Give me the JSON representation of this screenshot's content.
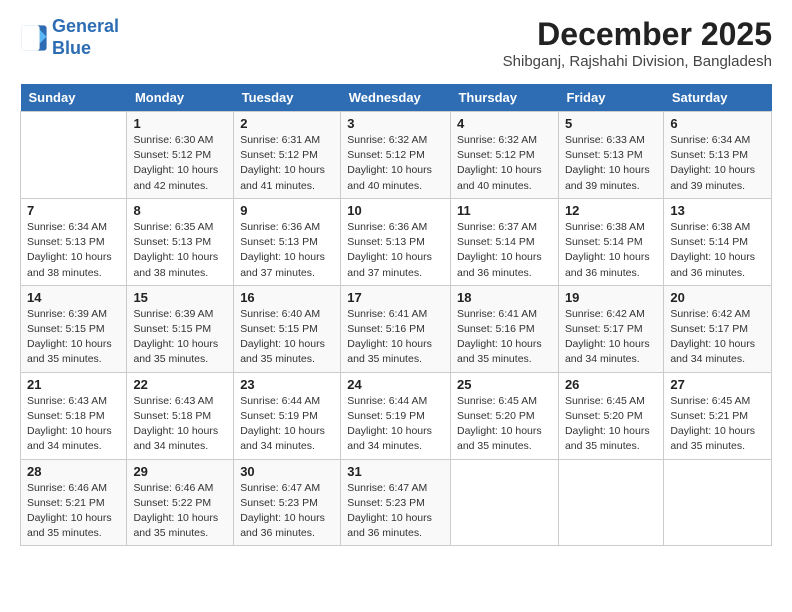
{
  "logo": {
    "line1": "General",
    "line2": "Blue"
  },
  "title": "December 2025",
  "subtitle": "Shibganj, Rajshahi Division, Bangladesh",
  "days_header": [
    "Sunday",
    "Monday",
    "Tuesday",
    "Wednesday",
    "Thursday",
    "Friday",
    "Saturday"
  ],
  "weeks": [
    [
      {
        "day": "",
        "sunrise": "",
        "sunset": "",
        "daylight": ""
      },
      {
        "day": "1",
        "sunrise": "Sunrise: 6:30 AM",
        "sunset": "Sunset: 5:12 PM",
        "daylight": "Daylight: 10 hours and 42 minutes."
      },
      {
        "day": "2",
        "sunrise": "Sunrise: 6:31 AM",
        "sunset": "Sunset: 5:12 PM",
        "daylight": "Daylight: 10 hours and 41 minutes."
      },
      {
        "day": "3",
        "sunrise": "Sunrise: 6:32 AM",
        "sunset": "Sunset: 5:12 PM",
        "daylight": "Daylight: 10 hours and 40 minutes."
      },
      {
        "day": "4",
        "sunrise": "Sunrise: 6:32 AM",
        "sunset": "Sunset: 5:12 PM",
        "daylight": "Daylight: 10 hours and 40 minutes."
      },
      {
        "day": "5",
        "sunrise": "Sunrise: 6:33 AM",
        "sunset": "Sunset: 5:13 PM",
        "daylight": "Daylight: 10 hours and 39 minutes."
      },
      {
        "day": "6",
        "sunrise": "Sunrise: 6:34 AM",
        "sunset": "Sunset: 5:13 PM",
        "daylight": "Daylight: 10 hours and 39 minutes."
      }
    ],
    [
      {
        "day": "7",
        "sunrise": "Sunrise: 6:34 AM",
        "sunset": "Sunset: 5:13 PM",
        "daylight": "Daylight: 10 hours and 38 minutes."
      },
      {
        "day": "8",
        "sunrise": "Sunrise: 6:35 AM",
        "sunset": "Sunset: 5:13 PM",
        "daylight": "Daylight: 10 hours and 38 minutes."
      },
      {
        "day": "9",
        "sunrise": "Sunrise: 6:36 AM",
        "sunset": "Sunset: 5:13 PM",
        "daylight": "Daylight: 10 hours and 37 minutes."
      },
      {
        "day": "10",
        "sunrise": "Sunrise: 6:36 AM",
        "sunset": "Sunset: 5:13 PM",
        "daylight": "Daylight: 10 hours and 37 minutes."
      },
      {
        "day": "11",
        "sunrise": "Sunrise: 6:37 AM",
        "sunset": "Sunset: 5:14 PM",
        "daylight": "Daylight: 10 hours and 36 minutes."
      },
      {
        "day": "12",
        "sunrise": "Sunrise: 6:38 AM",
        "sunset": "Sunset: 5:14 PM",
        "daylight": "Daylight: 10 hours and 36 minutes."
      },
      {
        "day": "13",
        "sunrise": "Sunrise: 6:38 AM",
        "sunset": "Sunset: 5:14 PM",
        "daylight": "Daylight: 10 hours and 36 minutes."
      }
    ],
    [
      {
        "day": "14",
        "sunrise": "Sunrise: 6:39 AM",
        "sunset": "Sunset: 5:15 PM",
        "daylight": "Daylight: 10 hours and 35 minutes."
      },
      {
        "day": "15",
        "sunrise": "Sunrise: 6:39 AM",
        "sunset": "Sunset: 5:15 PM",
        "daylight": "Daylight: 10 hours and 35 minutes."
      },
      {
        "day": "16",
        "sunrise": "Sunrise: 6:40 AM",
        "sunset": "Sunset: 5:15 PM",
        "daylight": "Daylight: 10 hours and 35 minutes."
      },
      {
        "day": "17",
        "sunrise": "Sunrise: 6:41 AM",
        "sunset": "Sunset: 5:16 PM",
        "daylight": "Daylight: 10 hours and 35 minutes."
      },
      {
        "day": "18",
        "sunrise": "Sunrise: 6:41 AM",
        "sunset": "Sunset: 5:16 PM",
        "daylight": "Daylight: 10 hours and 35 minutes."
      },
      {
        "day": "19",
        "sunrise": "Sunrise: 6:42 AM",
        "sunset": "Sunset: 5:17 PM",
        "daylight": "Daylight: 10 hours and 34 minutes."
      },
      {
        "day": "20",
        "sunrise": "Sunrise: 6:42 AM",
        "sunset": "Sunset: 5:17 PM",
        "daylight": "Daylight: 10 hours and 34 minutes."
      }
    ],
    [
      {
        "day": "21",
        "sunrise": "Sunrise: 6:43 AM",
        "sunset": "Sunset: 5:18 PM",
        "daylight": "Daylight: 10 hours and 34 minutes."
      },
      {
        "day": "22",
        "sunrise": "Sunrise: 6:43 AM",
        "sunset": "Sunset: 5:18 PM",
        "daylight": "Daylight: 10 hours and 34 minutes."
      },
      {
        "day": "23",
        "sunrise": "Sunrise: 6:44 AM",
        "sunset": "Sunset: 5:19 PM",
        "daylight": "Daylight: 10 hours and 34 minutes."
      },
      {
        "day": "24",
        "sunrise": "Sunrise: 6:44 AM",
        "sunset": "Sunset: 5:19 PM",
        "daylight": "Daylight: 10 hours and 34 minutes."
      },
      {
        "day": "25",
        "sunrise": "Sunrise: 6:45 AM",
        "sunset": "Sunset: 5:20 PM",
        "daylight": "Daylight: 10 hours and 35 minutes."
      },
      {
        "day": "26",
        "sunrise": "Sunrise: 6:45 AM",
        "sunset": "Sunset: 5:20 PM",
        "daylight": "Daylight: 10 hours and 35 minutes."
      },
      {
        "day": "27",
        "sunrise": "Sunrise: 6:45 AM",
        "sunset": "Sunset: 5:21 PM",
        "daylight": "Daylight: 10 hours and 35 minutes."
      }
    ],
    [
      {
        "day": "28",
        "sunrise": "Sunrise: 6:46 AM",
        "sunset": "Sunset: 5:21 PM",
        "daylight": "Daylight: 10 hours and 35 minutes."
      },
      {
        "day": "29",
        "sunrise": "Sunrise: 6:46 AM",
        "sunset": "Sunset: 5:22 PM",
        "daylight": "Daylight: 10 hours and 35 minutes."
      },
      {
        "day": "30",
        "sunrise": "Sunrise: 6:47 AM",
        "sunset": "Sunset: 5:23 PM",
        "daylight": "Daylight: 10 hours and 36 minutes."
      },
      {
        "day": "31",
        "sunrise": "Sunrise: 6:47 AM",
        "sunset": "Sunset: 5:23 PM",
        "daylight": "Daylight: 10 hours and 36 minutes."
      },
      {
        "day": "",
        "sunrise": "",
        "sunset": "",
        "daylight": ""
      },
      {
        "day": "",
        "sunrise": "",
        "sunset": "",
        "daylight": ""
      },
      {
        "day": "",
        "sunrise": "",
        "sunset": "",
        "daylight": ""
      }
    ]
  ]
}
